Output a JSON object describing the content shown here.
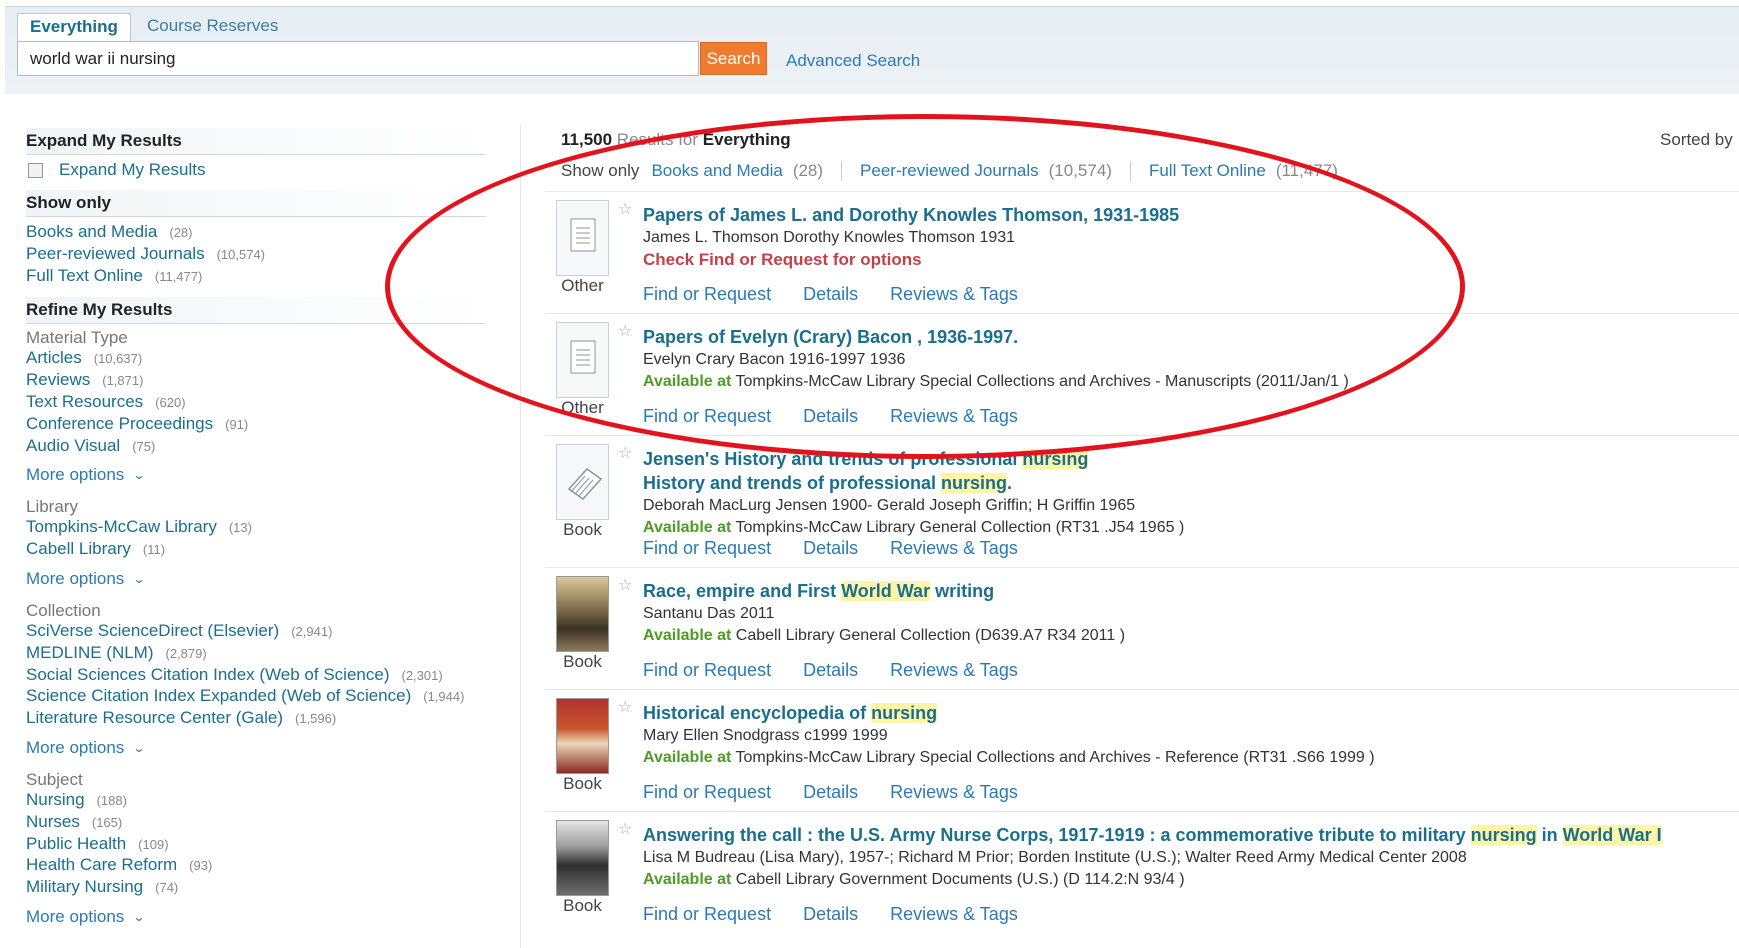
{
  "search": {
    "tabs": [
      "Everything",
      "Course Reserves"
    ],
    "query": "world war ii nursing",
    "button": "Search",
    "advanced": "Advanced Search"
  },
  "sidebar": {
    "expand_heading": "Expand My Results",
    "expand_checkbox": "Expand My Results",
    "show_only_heading": "Show only",
    "show_only": [
      {
        "label": "Books and Media",
        "count": "(28)"
      },
      {
        "label": "Peer-reviewed Journals",
        "count": "(10,574)"
      },
      {
        "label": "Full Text Online",
        "count": "(11,477)"
      }
    ],
    "refine_heading": "Refine My Results",
    "more_options": "More options",
    "groups": [
      {
        "title": "Material Type",
        "items": [
          {
            "label": "Articles",
            "count": "(10,637)"
          },
          {
            "label": "Reviews",
            "count": "(1,871)"
          },
          {
            "label": "Text Resources",
            "count": "(620)"
          },
          {
            "label": "Conference Proceedings",
            "count": "(91)"
          },
          {
            "label": "Audio Visual",
            "count": "(75)"
          }
        ]
      },
      {
        "title": "Library",
        "items": [
          {
            "label": "Tompkins-McCaw Library",
            "count": "(13)"
          },
          {
            "label": "Cabell Library",
            "count": "(11)"
          }
        ]
      },
      {
        "title": "Collection",
        "items": [
          {
            "label": "SciVerse ScienceDirect (Elsevier)",
            "count": "(2,941)"
          },
          {
            "label": "MEDLINE (NLM)",
            "count": "(2,879)"
          },
          {
            "label": "Social Sciences Citation Index (Web of Science)",
            "count": "(2,301)"
          },
          {
            "label": "Science Citation Index Expanded (Web of Science)",
            "count": "(1,944)"
          },
          {
            "label": "Literature Resource Center (Gale)",
            "count": "(1,596)"
          }
        ]
      },
      {
        "title": "Subject",
        "items": [
          {
            "label": "Nursing",
            "count": "(188)"
          },
          {
            "label": "Nurses",
            "count": "(165)"
          },
          {
            "label": "Public Health",
            "count": "(109)"
          },
          {
            "label": "Health Care Reform",
            "count": "(93)"
          },
          {
            "label": "Military Nursing",
            "count": "(74)"
          }
        ]
      }
    ]
  },
  "results_header": {
    "count": "11,500",
    "middle": "Results for",
    "scope": "Everything",
    "sorted": "Sorted by",
    "show_only_label": "Show only",
    "show_only": [
      {
        "label": "Books and Media",
        "count": "(28)"
      },
      {
        "label": "Peer-reviewed Journals",
        "count": "(10,574)"
      },
      {
        "label": "Full Text Online",
        "count": "(11,477)"
      }
    ]
  },
  "result_links": [
    "Find or Request",
    "Details",
    "Reviews & Tags"
  ],
  "available_at": "Available at",
  "results": [
    {
      "type": "Other",
      "title": "Papers of James L. and Dorothy Knowles Thomson, 1931-1985",
      "author": "James L. Thomson Dorothy Knowles Thomson 1931",
      "check": "Check Find or Request for options"
    },
    {
      "type": "Other",
      "title": "Papers of Evelyn (Crary) Bacon , 1936-1997.",
      "author": "Evelyn Crary Bacon 1916-1997 1936",
      "location": "Tompkins-McCaw Library Special Collections and Archives - Manuscripts (2011/Jan/1 )"
    },
    {
      "type": "Book",
      "title_a": "Jensen's History and trends of professional ",
      "title_a_hl": "nursing",
      "title_b": "History and trends of professional ",
      "title_b_hl": "nursing",
      "title_b_end": ".",
      "author": "Deborah MacLurg Jensen 1900- Gerald Joseph Griffin; H Griffin 1965",
      "location": "Tompkins-McCaw Library General Collection (RT31 .J54 1965 )"
    },
    {
      "type": "Book",
      "title_pre": "Race, empire and First ",
      "title_hl": "World War",
      "title_post": " writing",
      "author": "Santanu Das 2011",
      "location": "Cabell Library General Collection (D639.A7 R34 2011 )"
    },
    {
      "type": "Book",
      "title_pre": "Historical encyclopedia of ",
      "title_hl": "nursing",
      "author": "Mary Ellen Snodgrass c1999 1999",
      "location": "Tompkins-McCaw Library Special Collections and Archives - Reference (RT31 .S66 1999 )"
    },
    {
      "type": "Book",
      "title_pre": "Answering the call : the U.S. Army Nurse Corps, 1917-1919 : a commemorative tribute to military ",
      "title_hl": "nursing",
      "title_mid": " in ",
      "title_hl2": "World War I",
      "author": "Lisa M Budreau (Lisa Mary), 1957-; Richard M Prior; Borden Institute (U.S.); Walter Reed Army Medical Center 2008",
      "location": "Cabell Library Government Documents (U.S.) (D 114.2:N 93/4 )"
    }
  ]
}
